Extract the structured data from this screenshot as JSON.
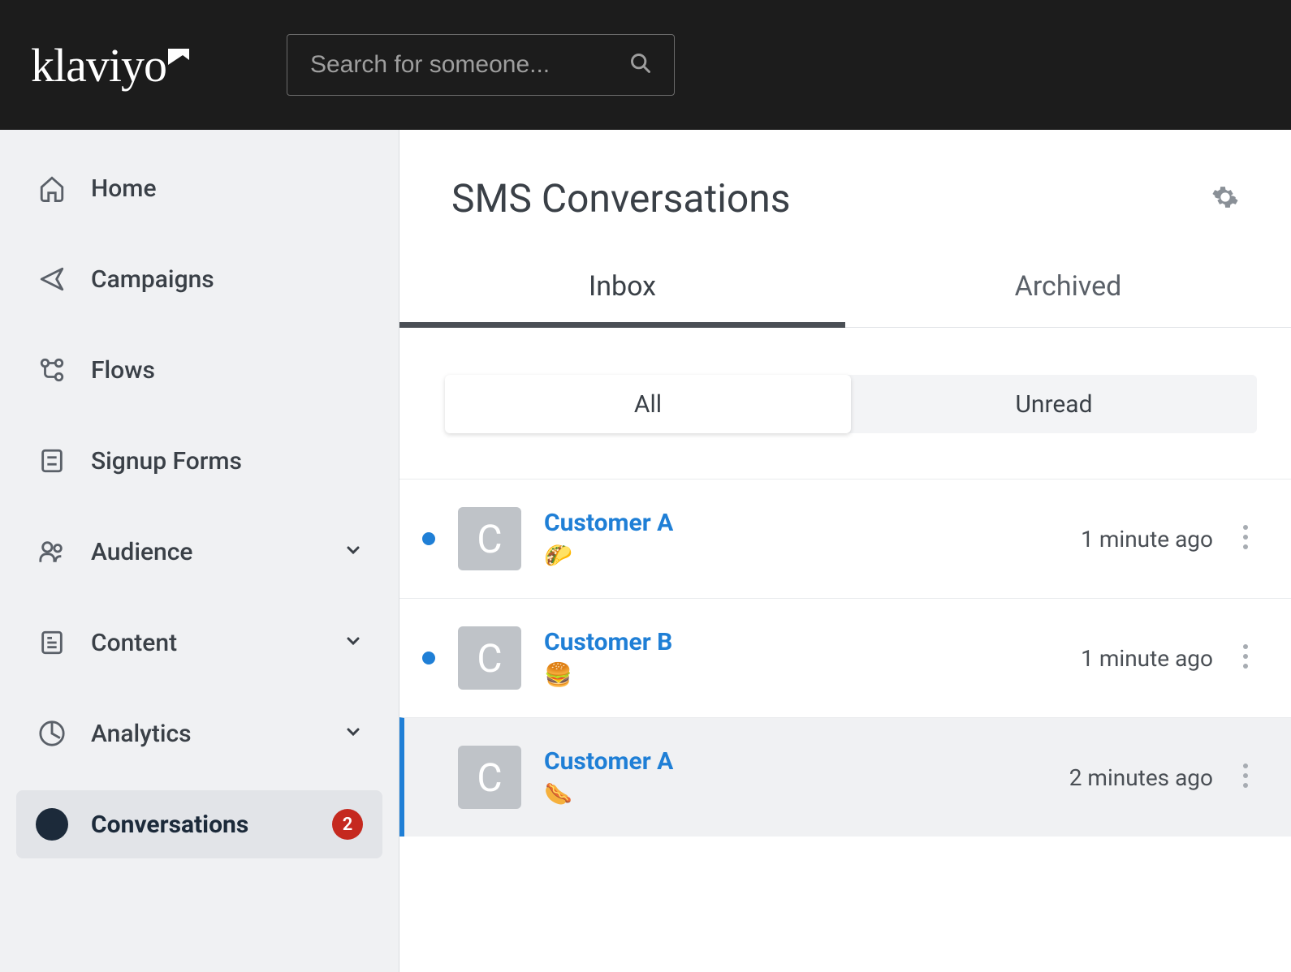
{
  "header": {
    "logo_text": "klaviyo",
    "search_placeholder": "Search for someone..."
  },
  "sidebar": {
    "items": [
      {
        "label": "Home",
        "has_chevron": false
      },
      {
        "label": "Campaigns",
        "has_chevron": false
      },
      {
        "label": "Flows",
        "has_chevron": false
      },
      {
        "label": "Signup Forms",
        "has_chevron": false
      },
      {
        "label": "Audience",
        "has_chevron": true
      },
      {
        "label": "Content",
        "has_chevron": true
      },
      {
        "label": "Analytics",
        "has_chevron": true
      },
      {
        "label": "Conversations",
        "has_chevron": false,
        "active": true,
        "badge": "2"
      }
    ]
  },
  "main": {
    "title": "SMS Conversations",
    "tabs": [
      {
        "label": "Inbox",
        "active": true
      },
      {
        "label": "Archived",
        "active": false
      }
    ],
    "filters": [
      {
        "label": "All",
        "active": true
      },
      {
        "label": "Unread",
        "active": false
      }
    ],
    "conversations": [
      {
        "name": "Customer A",
        "initial": "C",
        "preview": "🌮",
        "time": "1 minute ago",
        "unread": true,
        "selected": false
      },
      {
        "name": "Customer B",
        "initial": "C",
        "preview": "🍔",
        "time": "1 minute ago",
        "unread": true,
        "selected": false
      },
      {
        "name": "Customer A",
        "initial": "C",
        "preview": "🌭",
        "time": "2 minutes ago",
        "unread": false,
        "selected": true
      }
    ]
  }
}
